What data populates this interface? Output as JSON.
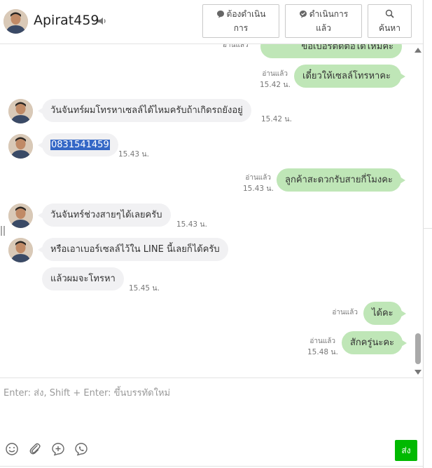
{
  "header": {
    "contact_name": "Apirat459",
    "buttons": [
      {
        "line1": "ต้องดำเนิน",
        "line2": "การ"
      },
      {
        "line1": "ดำเนินการ",
        "line2": "แล้ว"
      },
      {
        "line1": "",
        "line2": "ค้นหา"
      }
    ]
  },
  "messages": [
    {
      "direction": "out",
      "text": "ขอเบอร์ติดต่อได้ไหมคะ",
      "read": "อ่านแล้ว",
      "time": ""
    },
    {
      "direction": "out",
      "text": "เดี๋ยวให้เซลล์โทรหาคะ",
      "read": "อ่านแล้ว",
      "time": "15.42 น."
    },
    {
      "direction": "in",
      "text": "วันจันทร์ผมโทรหาเซลล์ได้ไหมครับถ้าเกิดรถยังอยู่",
      "time": "15.42 น."
    },
    {
      "direction": "in",
      "text": "0831541459",
      "time": "15.43 น."
    },
    {
      "direction": "out",
      "text": "ลูกค้าสะดวกรับสายกี่โมงคะ",
      "read": "อ่านแล้ว",
      "time": "15.43 น."
    },
    {
      "direction": "in",
      "text": "วันจันทร์ช่วงสายๆได้เลยครับ",
      "time": "15.43 น."
    },
    {
      "direction": "in",
      "text": "หรือเอาเบอร์เซลล์ไว้ใน LINE นี้เลยก็ได้ครับ",
      "time": ""
    },
    {
      "direction": "in",
      "text": "แล้วผมจะโทรหา",
      "time": "15.45 น."
    },
    {
      "direction": "out",
      "text": "ได้คะ",
      "read": "อ่านแล้ว",
      "time": ""
    },
    {
      "direction": "out",
      "text": "สักครู่นะคะ",
      "read": "อ่านแล้ว",
      "time": "15.48 น."
    }
  ],
  "composer": {
    "placeholder": "Enter: ส่ง, Shift + Enter: ขึ้นบรรทัดใหม่",
    "send_label": "ส่ง"
  },
  "colors": {
    "outgoing_bubble": "#bfe6b7",
    "incoming_bubble": "#f1f1f3",
    "send_button": "#00b900",
    "selection": "#3367c6"
  },
  "icons": [
    "speaker-icon",
    "chat-pending-icon",
    "chat-done-icon",
    "search-icon",
    "emoji-icon",
    "attach-icon",
    "add-icon",
    "call-icon"
  ]
}
